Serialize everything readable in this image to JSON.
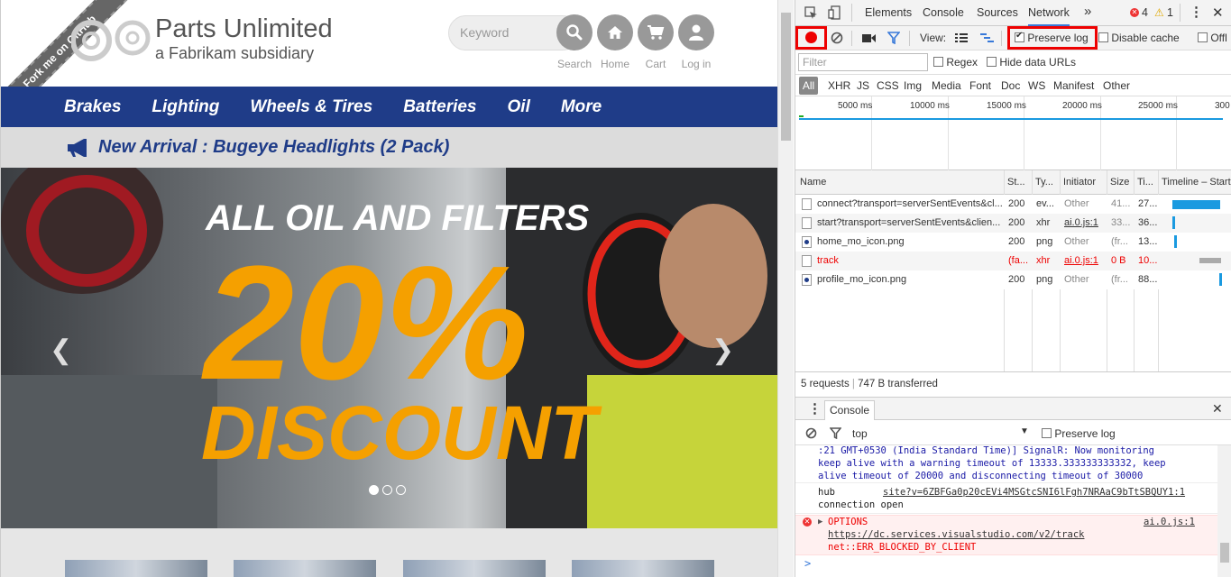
{
  "site": {
    "ribbon": "Fork me on GitHub",
    "brand_title": "Parts Unlimited",
    "brand_subtitle": "a Fabrikam subsidiary",
    "search_placeholder": "Keyword",
    "header_buttons": [
      {
        "label": "Search",
        "icon": "search-icon"
      },
      {
        "label": "Home",
        "icon": "home-icon"
      },
      {
        "label": "Cart",
        "icon": "cart-icon"
      },
      {
        "label": "Log in",
        "icon": "user-icon"
      }
    ],
    "nav": [
      "Brakes",
      "Lighting",
      "Wheels & Tires",
      "Batteries",
      "Oil",
      "More"
    ],
    "announcement": "New Arrival : Bugeye Headlights (2 Pack)",
    "hero": {
      "line1": "ALL OIL AND FILTERS",
      "percent": "20%",
      "line3": "DISCOUNT",
      "active_slide": 1,
      "slide_count": 3
    },
    "colors": {
      "nav": "#1f3c88",
      "accent": "#f5a000"
    }
  },
  "devtools": {
    "tabs": [
      "Elements",
      "Console",
      "Sources",
      "Network"
    ],
    "active_tab": "Network",
    "more": "»",
    "errors": "4",
    "warnings": "1",
    "toolbar": {
      "view_label": "View:",
      "preserve_log": "Preserve log",
      "preserve_log_checked": true,
      "disable_cache": "Disable cache",
      "offline": "Offl"
    },
    "filter_placeholder": "Filter",
    "regex": "Regex",
    "hide_data_urls": "Hide data URLs",
    "types": [
      "All",
      "XHR",
      "JS",
      "CSS",
      "Img",
      "Media",
      "Font",
      "Doc",
      "WS",
      "Manifest",
      "Other"
    ],
    "overview_ticks": [
      "5000 ms",
      "10000 ms",
      "15000 ms",
      "20000 ms",
      "25000 ms",
      "300"
    ],
    "columns": [
      "Name",
      "St...",
      "Ty...",
      "Initiator",
      "Size",
      "Ti...",
      "Timeline – Start"
    ],
    "requests": [
      {
        "name": "connect?transport=serverSentEvents&cl...",
        "status": "200",
        "type": "ev...",
        "initiator": "Other",
        "size": "41...",
        "time": "27...",
        "icon": "file",
        "error": false
      },
      {
        "name": "start?transport=serverSentEvents&clien...",
        "status": "200",
        "type": "xhr",
        "initiator": "ai.0.js:1",
        "size": "33...",
        "time": "36...",
        "icon": "file",
        "error": false
      },
      {
        "name": "home_mo_icon.png",
        "status": "200",
        "type": "png",
        "initiator": "Other",
        "size": "(fr...",
        "time": "13...",
        "icon": "img",
        "error": false
      },
      {
        "name": "track",
        "status": "(fa...",
        "type": "xhr",
        "initiator": "ai.0.js:1",
        "size": "0 B",
        "time": "10...",
        "icon": "file",
        "error": true
      },
      {
        "name": "profile_mo_icon.png",
        "status": "200",
        "type": "png",
        "initiator": "Other",
        "size": "(fr...",
        "time": "88...",
        "icon": "img",
        "error": false
      }
    ],
    "summary_requests": "5 requests",
    "summary_transferred": "747 B transferred",
    "drawer_tab": "Console",
    "console_context": "top",
    "console_preserve": "Preserve log",
    "console_lines": {
      "msg1_l1": ":21 GMT+0530 (India Standard Time)] SignalR: Now monitoring",
      "msg1_l2": "keep alive with a warning timeout of 13333.333333333332, keep",
      "msg1_l3": "alive timeout of 20000 and disconnecting timeout of 30000",
      "msg2_hub": "hub",
      "msg2_link": "site?v=6ZBFGa0p20cEVi4MSGtcSNI6lFgh7NRAaC9bTtSBQUY1:1",
      "msg2_l2": "connection open",
      "err_method": "OPTIONS",
      "err_source": "ai.0.js:1",
      "err_url": "https://dc.services.visualstudio.com/v2/track",
      "err_msg": "net::ERR_BLOCKED_BY_CLIENT",
      "prompt": ">"
    }
  }
}
